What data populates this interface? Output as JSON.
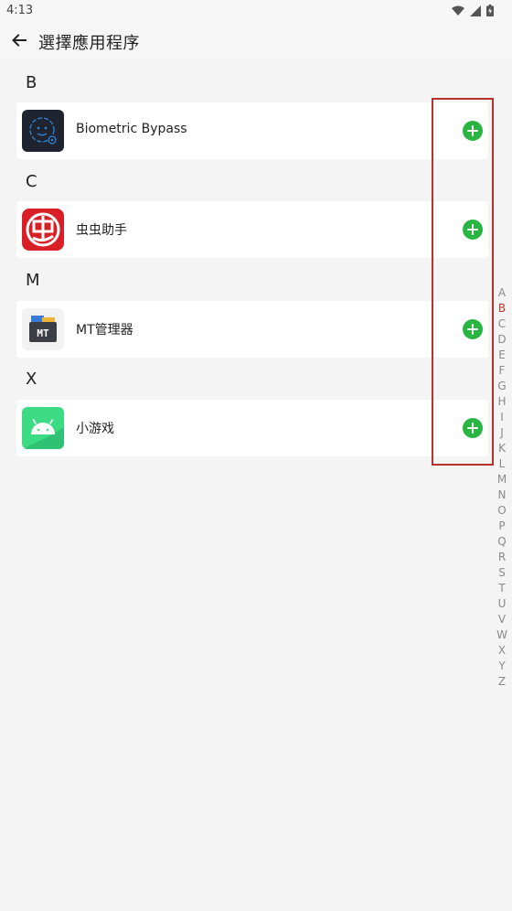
{
  "status_bar": {
    "time": "4:13"
  },
  "app_bar": {
    "title": "選擇應用程序"
  },
  "sections": [
    {
      "letter": "B",
      "app": {
        "name": "Biometric Bypass",
        "icon": "biometric-bypass-app-icon"
      }
    },
    {
      "letter": "C",
      "app": {
        "name": "虫虫助手",
        "icon": "chongchong-app-icon"
      }
    },
    {
      "letter": "M",
      "app": {
        "name": "MT管理器",
        "icon": "mt-manager-app-icon"
      }
    },
    {
      "letter": "X",
      "app": {
        "name": "小游戏",
        "icon": "android-app-icon"
      }
    }
  ],
  "alpha_index": {
    "active": "B",
    "letters": [
      "A",
      "B",
      "C",
      "D",
      "E",
      "F",
      "G",
      "H",
      "I",
      "J",
      "K",
      "L",
      "M",
      "N",
      "O",
      "P",
      "Q",
      "R",
      "S",
      "T",
      "U",
      "V",
      "W",
      "X",
      "Y",
      "Z"
    ]
  },
  "colors": {
    "add_button": "#2ab543",
    "index_active": "#c0392b",
    "highlight_box": "#b8322d"
  }
}
